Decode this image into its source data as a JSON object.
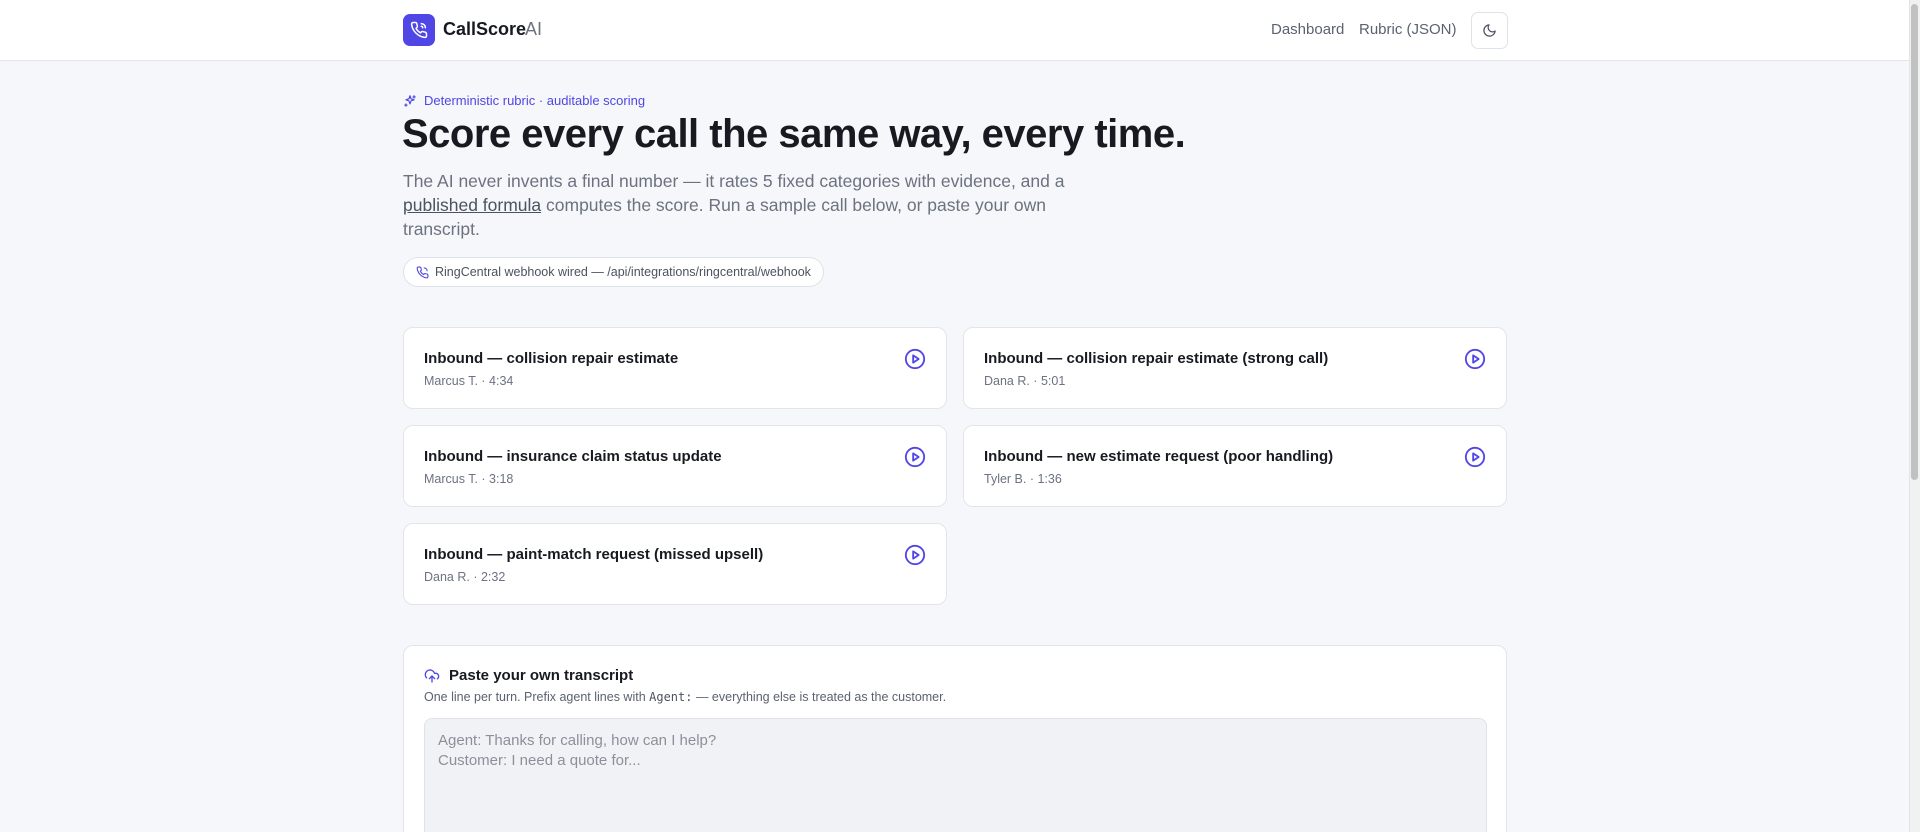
{
  "header": {
    "brand": "CallScore",
    "brand_suffix": "AI",
    "nav": [
      "Dashboard",
      "Rubric (JSON)"
    ]
  },
  "hero": {
    "eyebrow": "Deterministic rubric · auditable scoring",
    "title": "Score every call the same way, every time.",
    "subtitle_before": "The AI never invents a final number — it rates 5 fixed categories with evidence, and a ",
    "subtitle_link": "published formula",
    "subtitle_after": " computes the score. Run a sample call below, or paste your own transcript.",
    "pill": "RingCentral webhook wired — /api/integrations/ringcentral/webhook"
  },
  "samples": [
    {
      "title": "Inbound — collision repair estimate",
      "meta": "Marcus T. · 4:34"
    },
    {
      "title": "Inbound — collision repair estimate (strong call)",
      "meta": "Dana R. · 5:01"
    },
    {
      "title": "Inbound — insurance claim status update",
      "meta": "Marcus T. · 3:18"
    },
    {
      "title": "Inbound — new estimate request (poor handling)",
      "meta": "Tyler B. · 1:36"
    },
    {
      "title": "Inbound — paint-match request (missed upsell)",
      "meta": "Dana R. · 2:32"
    }
  ],
  "paste": {
    "title": "Paste your own transcript",
    "desc_before": "One line per turn. Prefix agent lines with ",
    "desc_code": "Agent:",
    "desc_after": " — everything else is treated as the customer.",
    "placeholder": "Agent: Thanks for calling, how can I help?\nCustomer: I need a quote for..."
  },
  "colors": {
    "accent": "#4f46e5",
    "background": "#f6f7fa"
  }
}
